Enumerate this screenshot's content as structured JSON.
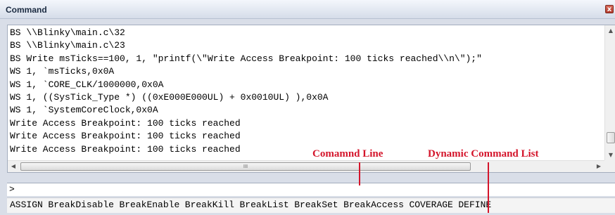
{
  "window": {
    "title": "Command",
    "close_glyph": "x"
  },
  "output_lines": [
    "BS \\\\Blinky\\main.c\\32",
    "BS \\\\Blinky\\main.c\\23",
    "BS Write msTicks==100, 1, \"printf(\\\"Write Access Breakpoint: 100 ticks reached\\\\n\\\");\"",
    "WS 1, `msTicks,0x0A",
    "WS 1, `CORE_CLK/1000000,0x0A",
    "WS 1, ((SysTick_Type *) ((0xE000E000UL) + 0x0010UL) ),0x0A",
    "WS 1, `SystemCoreClock,0x0A",
    "Write Access Breakpoint: 100 ticks reached",
    "Write Access Breakpoint: 100 ticks reached",
    "Write Access Breakpoint: 100 ticks reached"
  ],
  "scrollbar": {
    "up": "▲",
    "down": "▼",
    "left": "◀",
    "right": "▶",
    "grip": "III"
  },
  "command_line": {
    "prompt": ">",
    "value": ""
  },
  "command_list": [
    "ASSIGN",
    "BreakDisable",
    "BreakEnable",
    "BreakKill",
    "BreakList",
    "BreakSet",
    "BreakAccess",
    "COVERAGE",
    "DEFINE"
  ],
  "annotations": {
    "command_line": "Comamnd Line",
    "dynamic_list": "Dynamic Command List"
  },
  "colors": {
    "annotation": "#d4152b",
    "title_bg": "#d5dde9"
  }
}
